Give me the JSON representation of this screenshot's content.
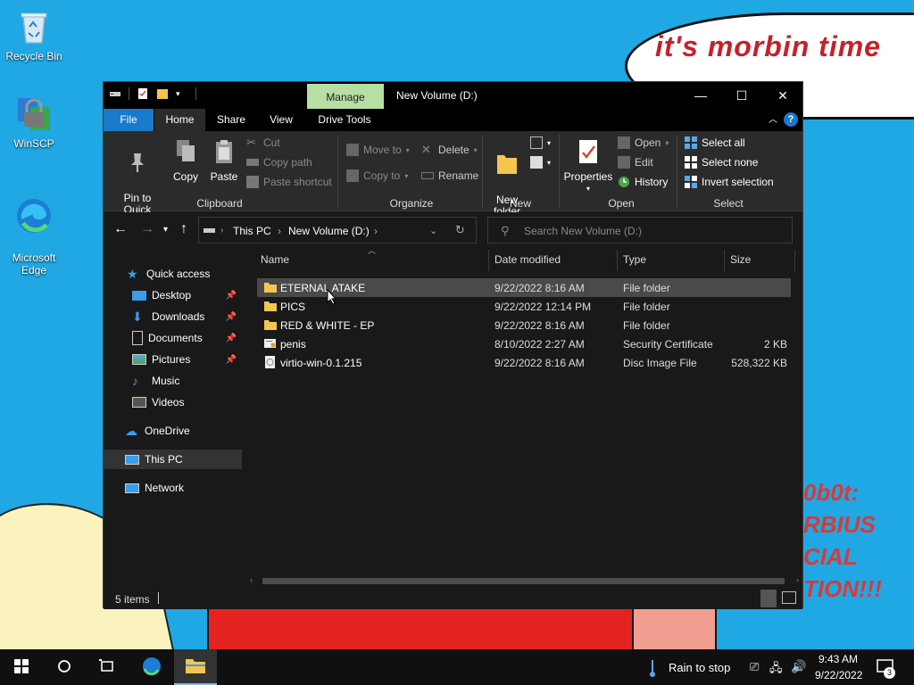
{
  "wallpaper": {
    "bubble_text": "it's morbin time",
    "side_text": "0b0t:\nRBIUS\nCIAL\nTION!!!"
  },
  "desktop_icons": [
    {
      "label": "Recycle Bin",
      "icon": "recycle-bin-icon"
    },
    {
      "label": "WinSCP",
      "icon": "winscp-icon"
    },
    {
      "label": "Microsoft\nEdge",
      "icon": "edge-icon"
    }
  ],
  "window": {
    "title": "New Volume (D:)",
    "context_tab": "Manage",
    "controls": {
      "minimize": "—",
      "maximize": "☐",
      "close": "✕"
    },
    "tabs": [
      "File",
      "Home",
      "Share",
      "View",
      "Drive Tools"
    ],
    "help": "?",
    "collapse": "︿"
  },
  "ribbon": {
    "clipboard": {
      "label": "Clipboard",
      "pin": "Pin to Quick\naccess",
      "copy": "Copy",
      "paste": "Paste",
      "cut": "Cut",
      "copy_path": "Copy path",
      "paste_shortcut": "Paste shortcut"
    },
    "organize": {
      "label": "Organize",
      "move_to": "Move to",
      "copy_to": "Copy to",
      "delete": "Delete",
      "rename": "Rename"
    },
    "new": {
      "label": "New",
      "new_folder": "New\nfolder"
    },
    "open": {
      "label": "Open",
      "properties": "Properties",
      "open": "Open",
      "edit": "Edit",
      "history": "History"
    },
    "select": {
      "label": "Select",
      "select_all": "Select all",
      "select_none": "Select none",
      "invert": "Invert selection"
    }
  },
  "address": {
    "crumbs": [
      "This PC",
      "New Volume (D:)"
    ],
    "search_placeholder": "Search New Volume (D:)"
  },
  "navpane": {
    "items": [
      {
        "label": "Quick access",
        "icon": "star-icon",
        "pinned": false
      },
      {
        "label": "Desktop",
        "icon": "desktop-icon",
        "pinned": true
      },
      {
        "label": "Downloads",
        "icon": "download-icon",
        "pinned": true
      },
      {
        "label": "Documents",
        "icon": "documents-icon",
        "pinned": true
      },
      {
        "label": "Pictures",
        "icon": "pictures-icon",
        "pinned": true
      },
      {
        "label": "Music",
        "icon": "music-icon",
        "pinned": false
      },
      {
        "label": "Videos",
        "icon": "videos-icon",
        "pinned": false
      },
      {
        "label": "OneDrive",
        "icon": "cloud-icon",
        "pinned": false
      },
      {
        "label": "This PC",
        "icon": "computer-icon",
        "pinned": false
      },
      {
        "label": "Network",
        "icon": "network-icon",
        "pinned": false
      }
    ]
  },
  "files": {
    "columns": [
      "Name",
      "Date modified",
      "Type",
      "Size"
    ],
    "rows": [
      {
        "name": "ETERNAL ATAKE",
        "date": "9/22/2022 8:16 AM",
        "type": "File folder",
        "size": "",
        "icon": "folder-icon"
      },
      {
        "name": "PICS",
        "date": "9/22/2022 12:14 PM",
        "type": "File folder",
        "size": "",
        "icon": "folder-icon"
      },
      {
        "name": "RED & WHITE - EP",
        "date": "9/22/2022 8:16 AM",
        "type": "File folder",
        "size": "",
        "icon": "folder-icon"
      },
      {
        "name": "penis",
        "date": "8/10/2022 2:27 AM",
        "type": "Security Certificate",
        "size": "2 KB",
        "icon": "certificate-icon"
      },
      {
        "name": "virtio-win-0.1.215",
        "date": "9/22/2022 8:16 AM",
        "type": "Disc Image File",
        "size": "528,322 KB",
        "icon": "disc-image-icon"
      }
    ]
  },
  "status": {
    "items_count": "5 items"
  },
  "taskbar": {
    "weather": "Rain to stop",
    "time": "9:43 AM",
    "date": "9/22/2022",
    "notification_count": "3"
  },
  "colors": {
    "accent": "#1979ca",
    "manage_tab": "#b7dea3",
    "folder": "#f5c64e",
    "window_bg": "#191919"
  }
}
